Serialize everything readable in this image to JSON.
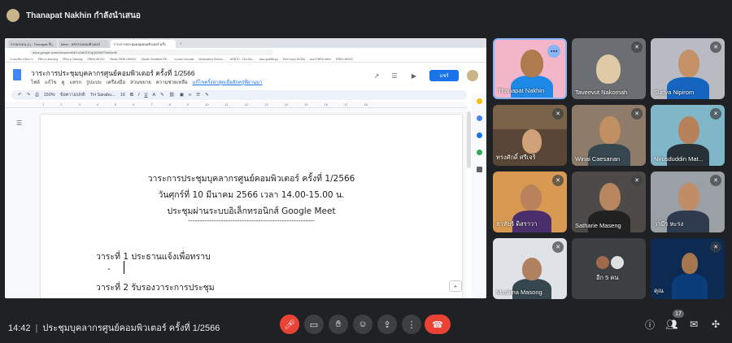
{
  "presenter": {
    "text": "Thanapat Nakhin กำลังนำเสนอ"
  },
  "browser": {
    "tabs": [
      "กรรมรถอน (1) - Thanapat กี่บุ",
      "Meet - หลักรรมคอมพิวเตอร์",
      "วาระการประชุมคลุมคอมพิวเตอร์ ครั้ง",
      "+"
    ],
    "url": "docs.google.com/document/d/1u2lbDDGqQ6ZkBTNzk/edit",
    "bookmarks": [
      "ระบบบริหารจัดการ",
      "PBru e-learning",
      "PBru e-Training",
      "PBRU MOOC",
      "Studio PBRU MOOC",
      "Studio Guideline PB...",
      "ระบบสารสนเทศ",
      "Information Techno...",
      "ARBTC - Orn Stu...",
      "สพอ.ศูนย์ข้อมูล",
      "กิจกรรมยุวนักวิจัย",
      "ลมย PBRU Wiriv",
      "PBRU MOOC"
    ]
  },
  "docs": {
    "title": "วาระการประชุมบุคลากรศูนย์คอมพิวเตอร์ ครั้งที่ 1/2566",
    "menus": [
      "ไฟล์",
      "แก้ไข",
      "ดู",
      "แทรก",
      "รูปแบบ",
      "เครื่องมือ",
      "ส่วนขยาย",
      "ความช่วยเหลือ"
    ],
    "last_edit": "แก้ไขครั้งล่าสุดเมื่อสักครู่ที่ผ่านมา",
    "share_label": "แชร์",
    "toolbar": {
      "zoom": "150%",
      "style": "ข้อความปกติ",
      "font": "TH Sarabu...",
      "size": "16"
    },
    "ruler": [
      "1",
      "2",
      "3",
      "4",
      "5",
      "6",
      "7",
      "8",
      "9",
      "10",
      "11",
      "12",
      "13",
      "14",
      "15",
      "16",
      "17",
      "18"
    ],
    "lines": {
      "heading1": "วาระการประชุมบุคลากรศูนย์คอมพิวเตอร์ ครั้งที่ 1/2566",
      "heading2": "วันศุกร์ที่ 10 มีนาคม 2566 เวลา 14.00-15.00 น.",
      "heading3": "ประชุมผ่านระบบอิเล็กทรอนิกส์ Google Meet",
      "divider": "------------------------------------------------------",
      "agenda1": "วาระที่ 1 ประธานแจ้งเพื่อทราบ",
      "bullet": "-",
      "agenda2": "วาระที่ 2 รับรองวาระการประชุม"
    }
  },
  "participants": [
    {
      "name": "Thanapat Nakhin"
    },
    {
      "name": "Taveevut Nakomah"
    },
    {
      "name": "Suriya Nipirom"
    },
    {
      "name": "ทรงศักดิ์ ศรีเจริ"
    },
    {
      "name": "Winai Caesanan"
    },
    {
      "name": "Nirusduddin Mat..."
    },
    {
      "name": "ฮาทัยร์ ดิสราวา"
    },
    {
      "name": "Satharie Maseng"
    },
    {
      "name": "วามีร หะรง"
    },
    {
      "name": "Muslima Masong"
    },
    {
      "name": "อีก 5 คน"
    },
    {
      "name": "คุณ"
    }
  ],
  "footer": {
    "time": "14:42",
    "meeting_name": "ประชุมบุคลากรศูนย์คอมพิวเตอร์ ครั้งที่ 1/2566",
    "participant_count": "17"
  },
  "colors": {
    "end_call": "#ea4335",
    "accent": "#8ab4f8",
    "docs_blue": "#1a73e8"
  }
}
